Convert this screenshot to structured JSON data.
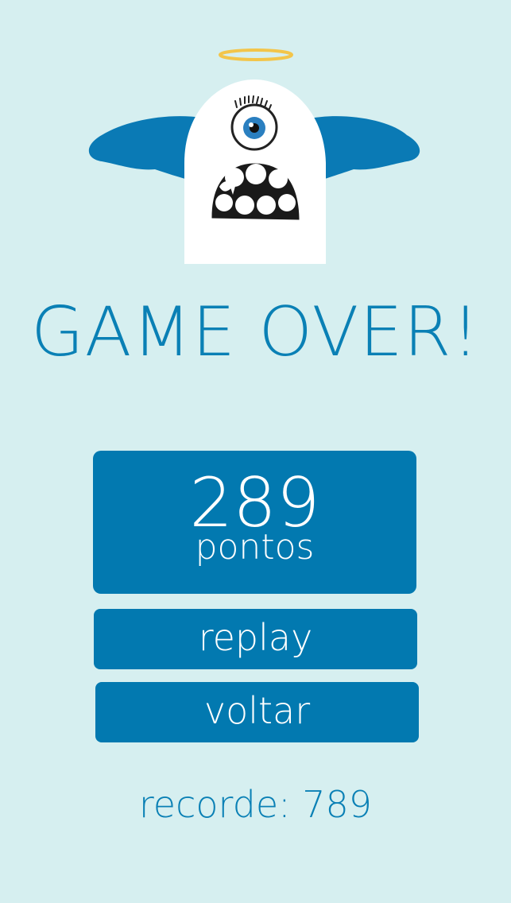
{
  "title": "GAME OVER!",
  "score": {
    "value": "289",
    "unit": "pontos"
  },
  "buttons": {
    "replay": "replay",
    "back": "voltar"
  },
  "record": "recorde: 789",
  "colors": {
    "background": "#d6eff0",
    "accent": "#0279b0",
    "text_accent": "#0a80b5",
    "halo": "#f3c54a"
  },
  "icons": {
    "mascot": "angel-monster-icon"
  }
}
